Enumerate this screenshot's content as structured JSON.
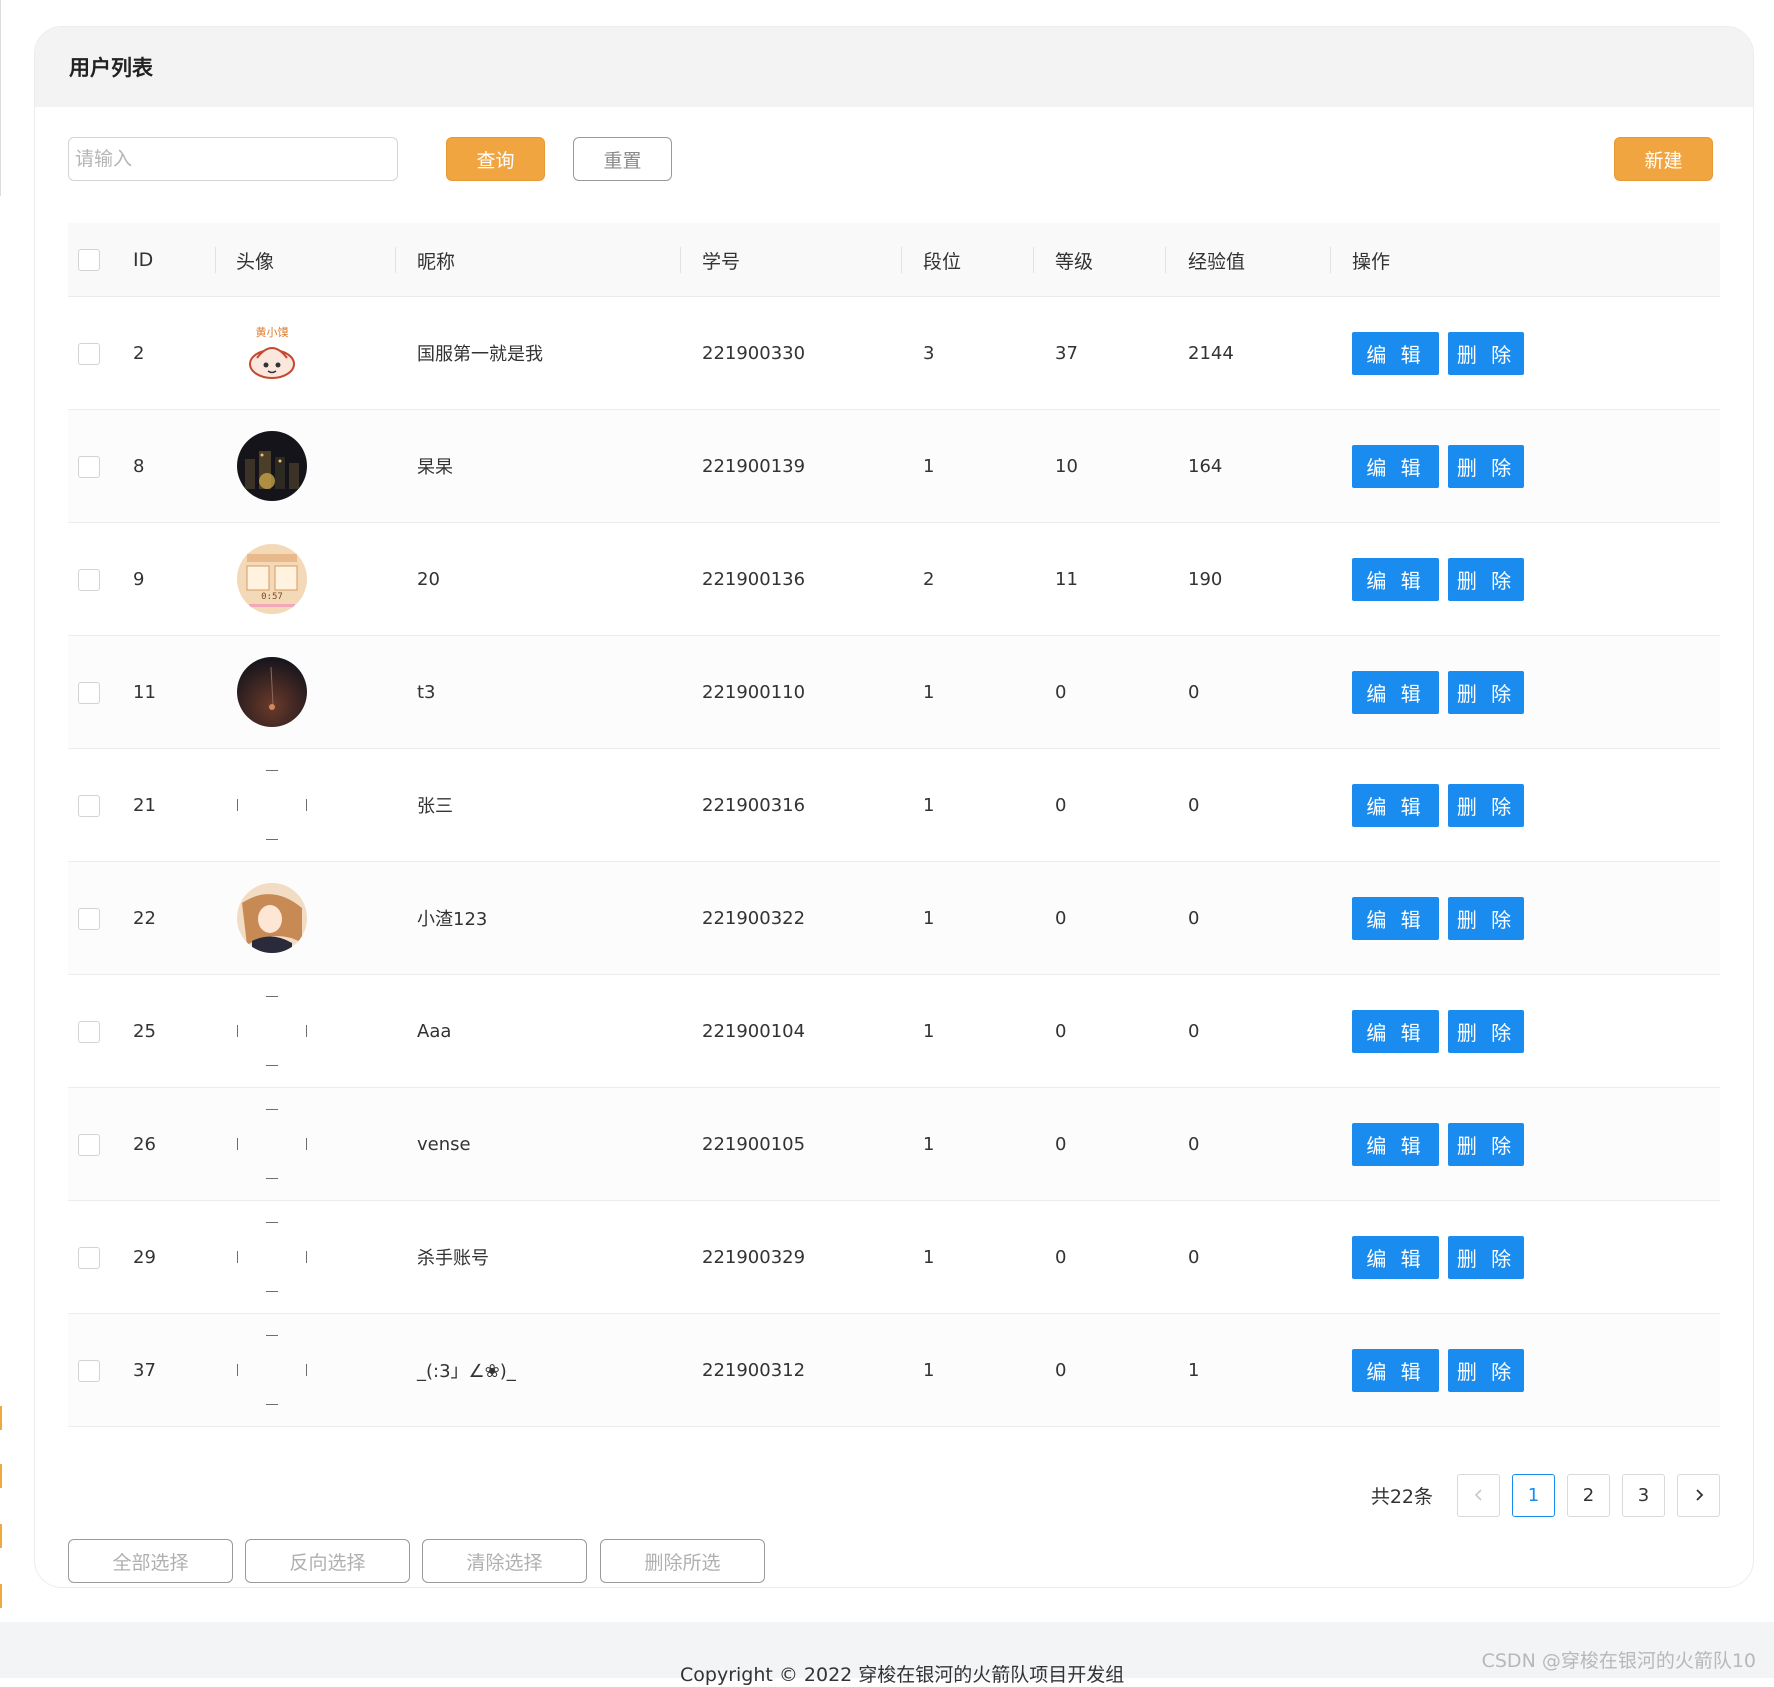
{
  "page": {
    "title": "用户列表"
  },
  "toolbar": {
    "search_placeholder": "请输入",
    "search_value": "",
    "query_label": "查询",
    "reset_label": "重置",
    "new_label": "新建"
  },
  "table": {
    "columns": [
      "ID",
      "头像",
      "昵称",
      "学号",
      "段位",
      "等级",
      "经验值",
      "操作"
    ],
    "edit_label": "编 辑",
    "delete_label": "删 除",
    "rows": [
      {
        "id": "2",
        "nickname": "国服第一就是我",
        "student_no": "221900330",
        "rank": "3",
        "level": "37",
        "exp": "2144",
        "avatar": "steamed-bun-cartoon"
      },
      {
        "id": "8",
        "nickname": "杲杲",
        "student_no": "221900139",
        "rank": "1",
        "level": "10",
        "exp": "164",
        "avatar": "night-city"
      },
      {
        "id": "9",
        "nickname": "20",
        "student_no": "221900136",
        "rank": "2",
        "level": "11",
        "exp": "190",
        "avatar": "timer-screen"
      },
      {
        "id": "11",
        "nickname": "t3",
        "student_no": "221900110",
        "rank": "1",
        "level": "0",
        "exp": "0",
        "avatar": "dark-sky"
      },
      {
        "id": "21",
        "nickname": "张三",
        "student_no": "221900316",
        "rank": "1",
        "level": "0",
        "exp": "0",
        "avatar": "broken"
      },
      {
        "id": "22",
        "nickname": "小渣123",
        "student_no": "221900322",
        "rank": "1",
        "level": "0",
        "exp": "0",
        "avatar": "anime-girl"
      },
      {
        "id": "25",
        "nickname": "Aaa",
        "student_no": "221900104",
        "rank": "1",
        "level": "0",
        "exp": "0",
        "avatar": "broken"
      },
      {
        "id": "26",
        "nickname": "vense",
        "student_no": "221900105",
        "rank": "1",
        "level": "0",
        "exp": "0",
        "avatar": "broken"
      },
      {
        "id": "29",
        "nickname": "杀手账号",
        "student_no": "221900329",
        "rank": "1",
        "level": "0",
        "exp": "0",
        "avatar": "broken"
      },
      {
        "id": "37",
        "nickname": "_(:3」∠❀)_",
        "student_no": "221900312",
        "rank": "1",
        "level": "0",
        "exp": "1",
        "avatar": "broken"
      }
    ]
  },
  "pagination": {
    "total_text": "共22条",
    "pages": [
      "1",
      "2",
      "3"
    ],
    "current": "1",
    "prev_icon": "chevron-left-icon",
    "next_icon": "chevron-right-icon"
  },
  "bulk_actions": {
    "select_all": "全部选择",
    "invert": "反向选择",
    "clear": "清除选择",
    "delete_selected": "删除所选"
  },
  "footer": {
    "copyright": "Copyright © 2022 穿梭在银河的火箭队项目开发组"
  },
  "watermark": "CSDN @穿梭在银河的火箭队10",
  "colors": {
    "accent_orange": "#f1a541",
    "primary_blue": "#1a8cf0"
  }
}
